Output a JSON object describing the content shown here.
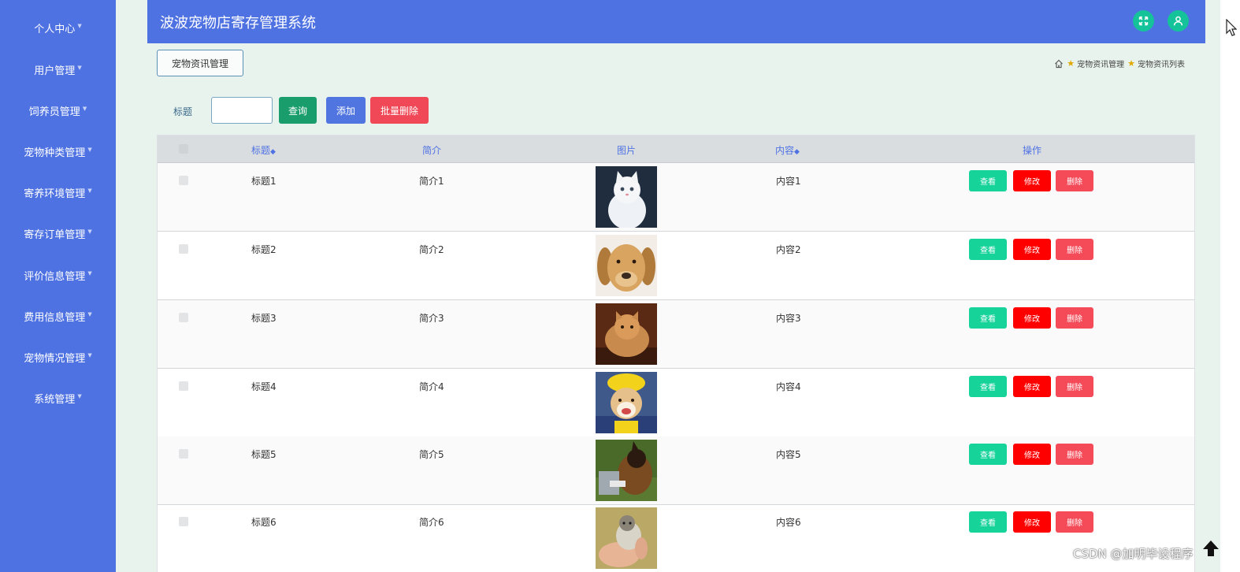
{
  "sidebar": {
    "items": [
      {
        "label": "个人中心"
      },
      {
        "label": "用户管理"
      },
      {
        "label": "饲养员管理"
      },
      {
        "label": "宠物种类管理"
      },
      {
        "label": "寄养环境管理"
      },
      {
        "label": "寄存订单管理"
      },
      {
        "label": "评价信息管理"
      },
      {
        "label": "费用信息管理"
      },
      {
        "label": "宠物情况管理"
      },
      {
        "label": "系统管理"
      }
    ]
  },
  "header": {
    "title": "波波宠物店寄存管理系统",
    "buttons": [
      {
        "icon": "fullscreen-icon"
      },
      {
        "icon": "user-icon"
      }
    ]
  },
  "breadcrumb": {
    "tab": "宠物资讯管理",
    "items": [
      "宠物资讯管理",
      "宠物资讯列表"
    ]
  },
  "search": {
    "label": "标题",
    "value": "",
    "query_button": "查询",
    "add_button": "添加",
    "batch_delete_button": "批量删除"
  },
  "table": {
    "headers": {
      "title": "标题",
      "summary": "简介",
      "image": "图片",
      "content": "内容",
      "actions": "操作"
    },
    "rows": [
      {
        "title": "标题1",
        "summary": "简介1",
        "content": "内容1",
        "image": "white-cat"
      },
      {
        "title": "标题2",
        "summary": "简介2",
        "content": "内容2",
        "image": "golden-retriever"
      },
      {
        "title": "标题3",
        "summary": "简介3",
        "content": "内容3",
        "image": "persian-cat"
      },
      {
        "title": "标题4",
        "summary": "简介4",
        "content": "内容4",
        "image": "shiba-yellow-hat"
      },
      {
        "title": "标题5",
        "summary": "简介5",
        "content": "内容5",
        "image": "german-shepherd"
      },
      {
        "title": "标题6",
        "summary": "简介6",
        "content": "内容6",
        "image": "kitten-in-hand"
      }
    ],
    "row_actions": {
      "view": "查看",
      "edit": "修改",
      "delete": "删除"
    }
  },
  "watermark": "CSDN @加明毕设程序",
  "colors": {
    "sidebar": "#4f72e3",
    "header": "#4f72e3",
    "page_bg": "#e9f3ee",
    "query": "#1a9d6c",
    "add": "#5075e0",
    "batch_delete": "#f04856",
    "view": "#16d39a",
    "edit": "#ff0000",
    "delete": "#f54a58"
  }
}
